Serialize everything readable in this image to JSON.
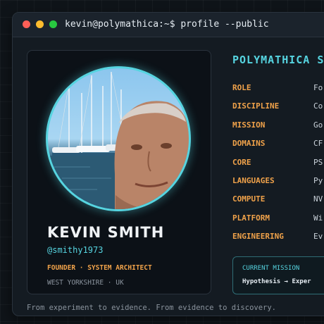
{
  "window": {
    "title": "kevin@polymathica:~$ profile --public"
  },
  "profile": {
    "name": "KEVIN SMITH",
    "handle": "@smithy1973",
    "roles": "FOUNDER · SYSTEM ARCHITECT",
    "location": "WEST YORKSHIRE · UK",
    "avatar_alt": "profile photo"
  },
  "details": {
    "title": "POLYMATHICA S",
    "rows": [
      {
        "key": "ROLE",
        "value": "Fo"
      },
      {
        "key": "DISCIPLINE",
        "value": "Co"
      },
      {
        "key": "MISSION",
        "value": "Go"
      },
      {
        "key": "DOMAINS",
        "value": "CF"
      },
      {
        "key": "CORE",
        "value": "PS"
      },
      {
        "key": "LANGUAGES",
        "value": "Py"
      },
      {
        "key": "COMPUTE",
        "value": "NV"
      },
      {
        "key": "PLATFORM",
        "value": "Wi"
      },
      {
        "key": "ENGINEERING",
        "value": "Ev"
      }
    ]
  },
  "mission_box": {
    "label": "CURRENT MISSION",
    "text": "Hypothesis → Exper"
  },
  "footer": {
    "tagline": "From experiment to evidence. From evidence to discovery."
  },
  "colors": {
    "accent": "#56d4e0",
    "key": "#f0a24a",
    "background": "#0f1419"
  }
}
